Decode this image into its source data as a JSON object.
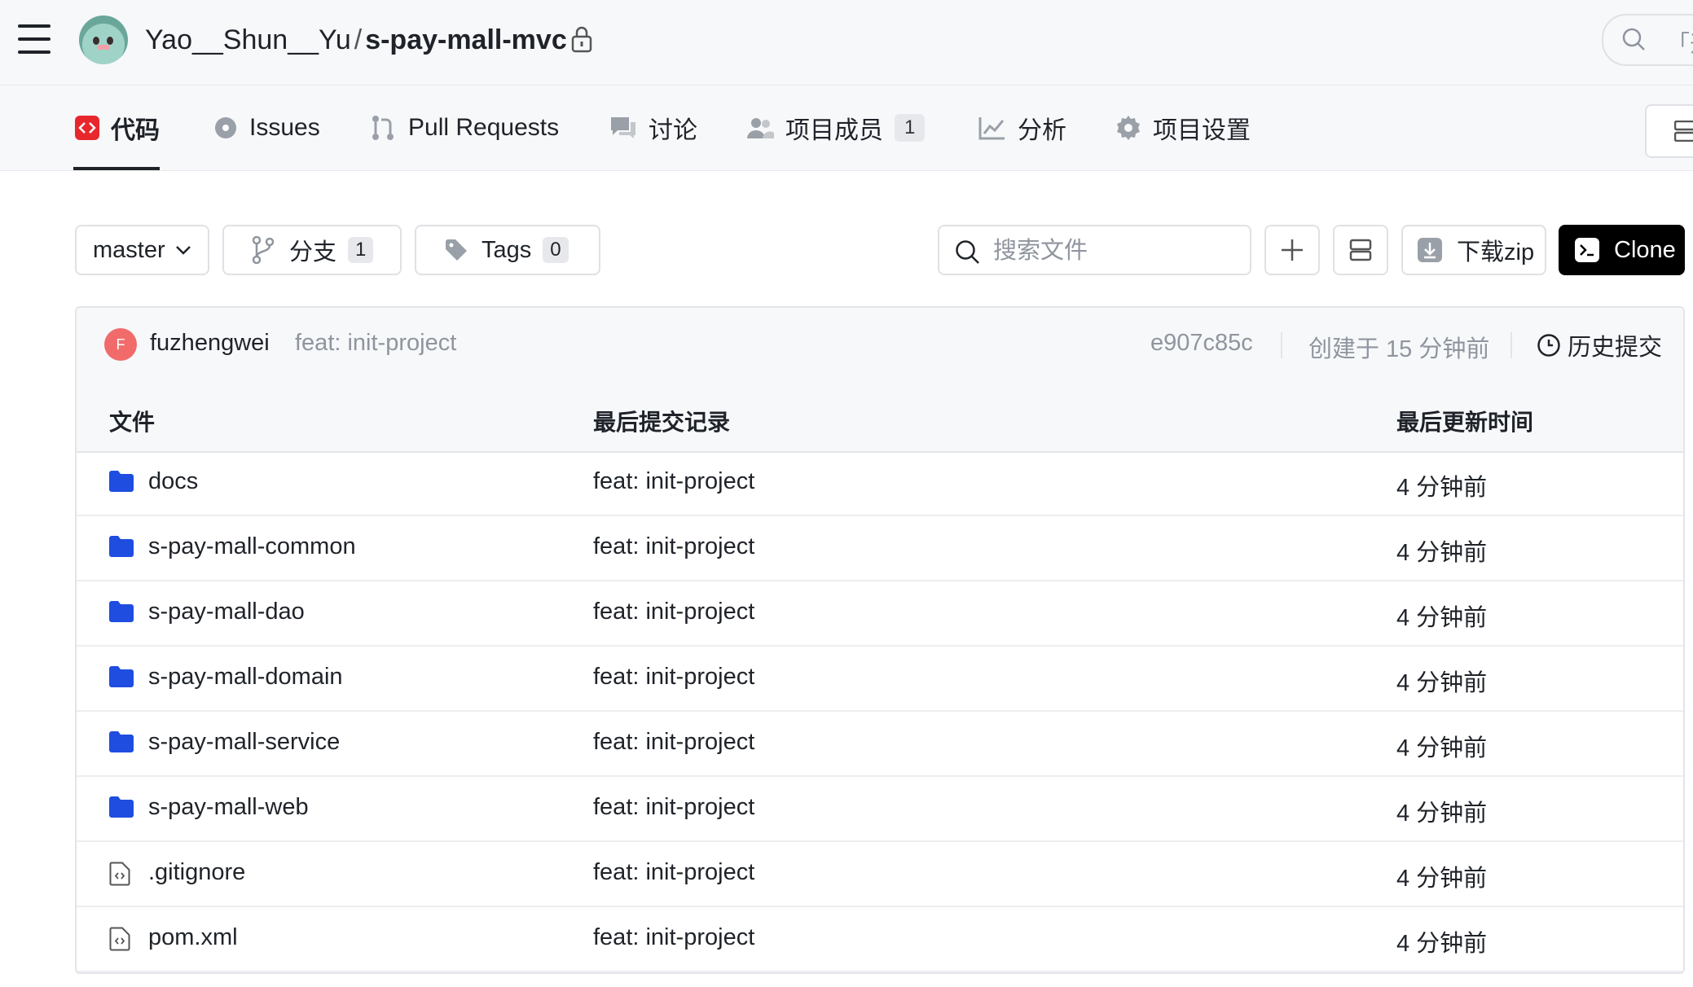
{
  "header": {
    "owner": "Yao__Shun__Yu",
    "separator": "/",
    "repo": "s-pay-mall-mvc",
    "search_text": "「开"
  },
  "tabs": [
    {
      "label": "代码",
      "icon": "code-icon",
      "active": true
    },
    {
      "label": "Issues",
      "icon": "issues-icon"
    },
    {
      "label": "Pull Requests",
      "icon": "pull-request-icon"
    },
    {
      "label": "讨论",
      "icon": "discussion-icon"
    },
    {
      "label": "项目成员",
      "icon": "members-icon",
      "badge": "1"
    },
    {
      "label": "分析",
      "icon": "analytics-icon"
    },
    {
      "label": "项目设置",
      "icon": "settings-icon"
    }
  ],
  "toolbar": {
    "branch": "master",
    "branches_label": "分支",
    "branches_count": "1",
    "tags_label": "Tags",
    "tags_count": "0",
    "search_placeholder": "搜索文件",
    "download_label": "下载zip",
    "clone_label": "Clone"
  },
  "commit": {
    "avatar_letter": "F",
    "author": "fuzhengwei",
    "message": "feat: init-project",
    "hash": "e907c85c",
    "time": "创建于 15 分钟前",
    "history_label": "历史提交"
  },
  "table": {
    "columns": [
      "文件",
      "最后提交记录",
      "最后更新时间"
    ],
    "rows": [
      {
        "name": "docs",
        "type": "folder",
        "commit": "feat: init-project",
        "updated": "4 分钟前"
      },
      {
        "name": "s-pay-mall-common",
        "type": "folder",
        "commit": "feat: init-project",
        "updated": "4 分钟前"
      },
      {
        "name": "s-pay-mall-dao",
        "type": "folder",
        "commit": "feat: init-project",
        "updated": "4 分钟前"
      },
      {
        "name": "s-pay-mall-domain",
        "type": "folder",
        "commit": "feat: init-project",
        "updated": "4 分钟前"
      },
      {
        "name": "s-pay-mall-service",
        "type": "folder",
        "commit": "feat: init-project",
        "updated": "4 分钟前"
      },
      {
        "name": "s-pay-mall-web",
        "type": "folder",
        "commit": "feat: init-project",
        "updated": "4 分钟前"
      },
      {
        "name": ".gitignore",
        "type": "file",
        "commit": "feat: init-project",
        "updated": "4 分钟前"
      },
      {
        "name": "pom.xml",
        "type": "file",
        "commit": "feat: init-project",
        "updated": "4 分钟前"
      }
    ]
  },
  "colors": {
    "accent": "#e8272d",
    "folder": "#1f4de0",
    "clone_bg": "#000000",
    "muted_text": "#8f959e"
  }
}
